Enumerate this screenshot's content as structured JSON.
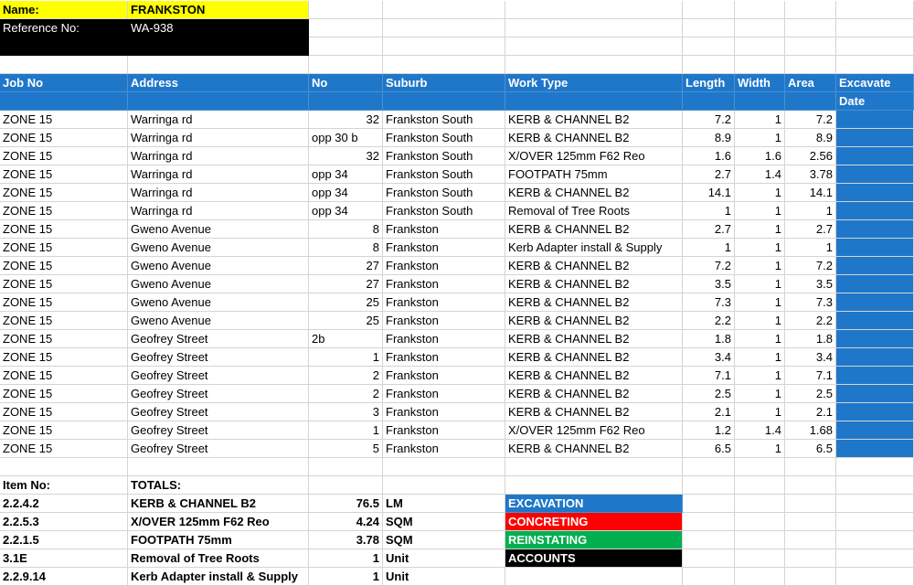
{
  "info": {
    "name_label": "Name:",
    "name_value": "FRANKSTON",
    "ref_label": "Reference No:",
    "ref_value": "WA-938"
  },
  "headers": [
    "Job No",
    "Address",
    "No",
    "Suburb",
    "Work Type",
    "Length",
    "Width",
    "Area",
    "Excavate"
  ],
  "header_row2": [
    "",
    "",
    "",
    "",
    "",
    "",
    "",
    "",
    "Date"
  ],
  "rows": [
    [
      "ZONE 15",
      "Warringa rd",
      "32",
      "Frankston South",
      "KERB & CHANNEL B2",
      "7.2",
      "1",
      "7.2"
    ],
    [
      "ZONE 15",
      "Warringa rd",
      "opp 30 b",
      "Frankston South",
      "KERB & CHANNEL B2",
      "8.9",
      "1",
      "8.9"
    ],
    [
      "ZONE 15",
      "Warringa rd",
      "32",
      "Frankston South",
      "X/OVER 125mm F62 Reo",
      "1.6",
      "1.6",
      "2.56"
    ],
    [
      "ZONE 15",
      "Warringa rd",
      "opp 34",
      "Frankston South",
      "FOOTPATH 75mm",
      "2.7",
      "1.4",
      "3.78"
    ],
    [
      "ZONE 15",
      "Warringa rd",
      "opp 34",
      "Frankston South",
      "KERB & CHANNEL B2",
      "14.1",
      "1",
      "14.1"
    ],
    [
      "ZONE 15",
      "Warringa rd",
      "opp 34",
      "Frankston South",
      "Removal of Tree Roots",
      "1",
      "1",
      "1"
    ],
    [
      "ZONE 15",
      "Gweno Avenue",
      "8",
      "Frankston",
      "KERB & CHANNEL B2",
      "2.7",
      "1",
      "2.7"
    ],
    [
      "ZONE 15",
      "Gweno Avenue",
      "8",
      "Frankston",
      "Kerb Adapter install & Supply",
      "1",
      "1",
      "1"
    ],
    [
      "ZONE 15",
      "Gweno Avenue",
      "27",
      "Frankston",
      "KERB & CHANNEL B2",
      "7.2",
      "1",
      "7.2"
    ],
    [
      "ZONE 15",
      "Gweno Avenue",
      "27",
      "Frankston",
      "KERB & CHANNEL B2",
      "3.5",
      "1",
      "3.5"
    ],
    [
      "ZONE 15",
      "Gweno Avenue",
      "25",
      "Frankston",
      "KERB & CHANNEL B2",
      "7.3",
      "1",
      "7.3"
    ],
    [
      "ZONE 15",
      "Gweno Avenue",
      "25",
      "Frankston",
      "KERB & CHANNEL B2",
      "2.2",
      "1",
      "2.2"
    ],
    [
      "ZONE 15",
      "Geofrey Street",
      "2b",
      "Frankston",
      "KERB & CHANNEL B2",
      "1.8",
      "1",
      "1.8"
    ],
    [
      "ZONE 15",
      "Geofrey Street",
      "1",
      "Frankston",
      "KERB & CHANNEL B2",
      "3.4",
      "1",
      "3.4"
    ],
    [
      "ZONE 15",
      "Geofrey Street",
      "2",
      "Frankston",
      "KERB & CHANNEL B2",
      "7.1",
      "1",
      "7.1"
    ],
    [
      "ZONE 15",
      "Geofrey Street",
      "2",
      "Frankston",
      "KERB & CHANNEL B2",
      "2.5",
      "1",
      "2.5"
    ],
    [
      "ZONE 15",
      "Geofrey Street",
      "3",
      "Frankston",
      "KERB & CHANNEL B2",
      "2.1",
      "1",
      "2.1"
    ],
    [
      "ZONE 15",
      "Geofrey Street",
      "1",
      "Frankston",
      "X/OVER 125mm F62 Reo",
      "1.2",
      "1.4",
      "1.68"
    ],
    [
      "ZONE 15",
      "Geofrey Street",
      "5",
      "Frankston",
      "KERB & CHANNEL B2",
      "6.5",
      "1",
      "6.5"
    ]
  ],
  "totals": {
    "item_label": "Item No:",
    "totals_label": "TOTALS:",
    "items": [
      [
        "2.2.4.2",
        "KERB & CHANNEL B2",
        "76.5",
        "LM"
      ],
      [
        "2.2.5.3",
        "X/OVER 125mm F62 Reo",
        "4.24",
        "SQM"
      ],
      [
        "2.2.1.5",
        "FOOTPATH 75mm",
        "3.78",
        "SQM"
      ],
      [
        "3.1E",
        "Removal of Tree Roots",
        "1",
        "Unit"
      ],
      [
        "2.2.9.14",
        "Kerb Adapter install & Supply",
        "1",
        "Unit"
      ]
    ]
  },
  "legend": [
    {
      "label": "EXCAVATION",
      "color": "#1f77c9"
    },
    {
      "label": "CONCRETING",
      "color": "#ff0000"
    },
    {
      "label": "REINSTATING",
      "color": "#00b050"
    },
    {
      "label": "ACCOUNTS",
      "color": "#000000"
    }
  ]
}
